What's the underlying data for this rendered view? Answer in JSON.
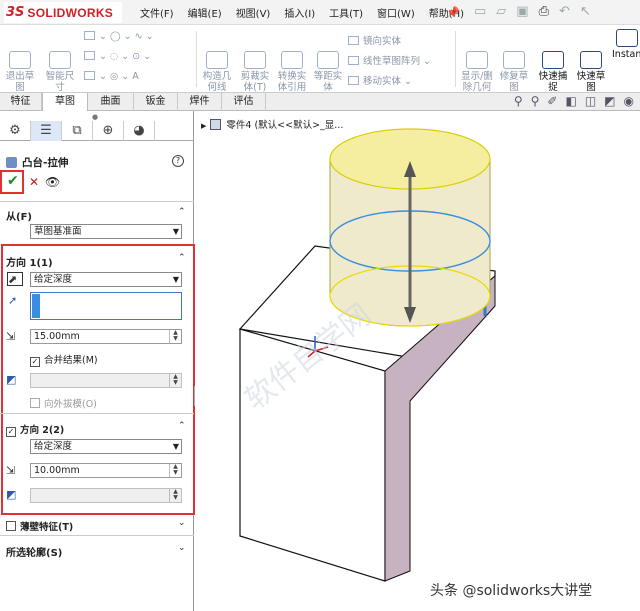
{
  "app": {
    "logo_ds": "3S",
    "logo_name": "SOLIDWORKS",
    "menu": [
      "文件(F)",
      "编辑(E)",
      "视图(V)",
      "插入(I)",
      "工具(T)",
      "窗口(W)",
      "帮助(H)"
    ]
  },
  "ribbon": {
    "exit_sketch": "退出草\n图",
    "smart_dim": "智能尺\n寸",
    "construct": "构造几\n何线",
    "cut_entity": "剪裁实\n体(T)",
    "convert": "转换实\n体引用",
    "offset": "等距实\n体",
    "mirror": "镜向实体",
    "linear_pattern": "线性草图阵列",
    "move": "移动实体",
    "show_delete": "显示/删\n除几何\n关系",
    "repair": "修复草\n图",
    "quick_snap": "快速捕\n捉",
    "rapid_sketch": "快速草\n图",
    "instant": "Instant"
  },
  "tabs": [
    "特征",
    "草图",
    "曲面",
    "钣金",
    "焊件",
    "评估"
  ],
  "active_tab": "草图",
  "panel": {
    "title": "凸台-拉伸",
    "from_label": "从(F)",
    "from_value": "草图基准面",
    "dir1_label": "方向 1(1)",
    "dir1_type": "给定深度",
    "dir1_depth": "15.00mm",
    "merge_label": "合并结果(M)",
    "draft_outward": "向外拔模(O)",
    "dir2_label": "方向 2(2)",
    "dir2_type": "给定深度",
    "dir2_depth": "10.00mm",
    "thin_label": "薄壁特征(T)",
    "contours_label": "所选轮廓(S)"
  },
  "viewport": {
    "tree_label": "零件4 (默认<<默认>_显..."
  },
  "watermark": "头条 @solidworks大讲堂",
  "watermark_diag": "软件自学网"
}
